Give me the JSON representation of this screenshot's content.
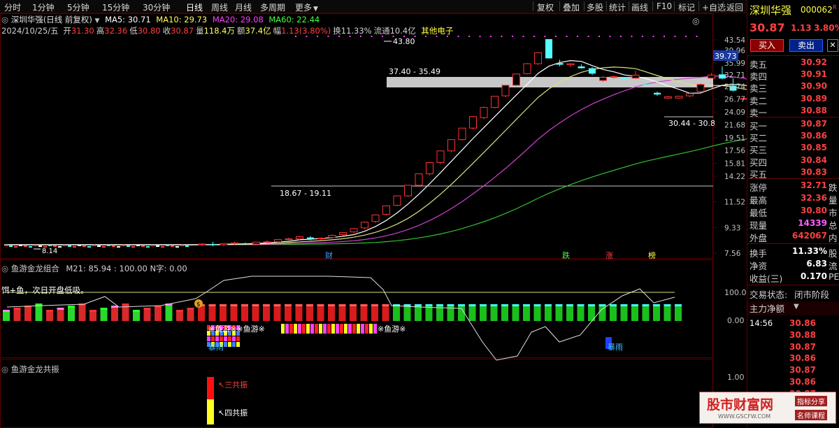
{
  "toolbar": {
    "timeframes": [
      "分时",
      "1分钟",
      "5分钟",
      "15分钟",
      "30分钟",
      "日线",
      "周线",
      "月线",
      "多周期",
      "更多"
    ],
    "active": "日线",
    "buttons": [
      "复权",
      "叠加",
      "多股",
      "统计",
      "画线",
      "F10",
      "标记",
      "+自选",
      "返回"
    ]
  },
  "chart_header": {
    "title": "深圳华强(日线 前复权)",
    "ma": [
      {
        "label": "MA5: 30.71",
        "color": "#ffffff"
      },
      {
        "label": "MA10: 29.73",
        "color": "#ffff60"
      },
      {
        "label": "MA20: 29.08",
        "color": "#ff40ff"
      },
      {
        "label": "MA60: 22.44",
        "color": "#40ff40"
      }
    ],
    "date": "2024/10/25/五",
    "quote": [
      {
        "label": "开",
        "value": "31.30",
        "color": "#ff4040"
      },
      {
        "label": "高",
        "value": "32.36",
        "color": "#ff4040"
      },
      {
        "label": "低",
        "value": "30.80",
        "color": "#ff4040"
      },
      {
        "label": "收",
        "value": "30.87",
        "color": "#ff4040"
      },
      {
        "label": "量",
        "value": "118.4万",
        "color": "#ffff60"
      },
      {
        "label": "额",
        "value": "37.4亿",
        "color": "#ffff60"
      },
      {
        "label": "幅",
        "value": "1.13(3.80%)",
        "color": "#ff4040"
      },
      {
        "label": "换",
        "value": "11.33%",
        "color": "#d0d0d0"
      },
      {
        "label": "流通",
        "value": "10.4亿",
        "color": "#d0d0d0"
      }
    ],
    "sector": "其他电子"
  },
  "price_axis": {
    "labels": [
      "43.54",
      "39.96",
      "35.99",
      "32.71",
      "29.74",
      "26.77",
      "24.09",
      "21.68",
      "19.51",
      "17.56",
      "15.81",
      "14.22",
      "11.52",
      "9.33",
      "7.56"
    ],
    "cursor_value": "39.73"
  },
  "annotations": {
    "peak": "43.80",
    "range_top": "37.40 - 35.49",
    "range_mid": "18.67 - 19.11",
    "range_right": "30.44 - 30.8",
    "low": "8.14",
    "markers": [
      {
        "text": "财",
        "color": "#40a0ff"
      },
      {
        "text": "跌",
        "color": "#40ff40"
      },
      {
        "text": "涨",
        "color": "#ff4040"
      },
      {
        "text": "榜",
        "color": "#ffff40"
      }
    ]
  },
  "indicator1": {
    "title": "鱼游金龙组合",
    "values": "M21: 85.94 : 100.00 N字: 0.00",
    "note": "饵+鱼，次日开盘低吸。",
    "axis": [
      "100.0",
      "0.00"
    ],
    "fish_label": "※鱼游※※鱼游※",
    "fish_label2": "※鱼游※",
    "rain": "暴雨"
  },
  "indicator2": {
    "title": "鱼游金龙共振",
    "axis": [
      "1.00"
    ],
    "label_three": "三共振",
    "label_four": "四共振"
  },
  "sidebar": {
    "name": "深圳华强",
    "code": "000062",
    "price": "30.87",
    "change": "1.13",
    "pct": "3.80%",
    "buy_btn": "买入",
    "sell_btn": "卖出",
    "asks": [
      {
        "label": "卖五",
        "price": "30.92"
      },
      {
        "label": "卖四",
        "price": "30.91"
      },
      {
        "label": "卖三",
        "price": "30.90"
      },
      {
        "label": "卖二",
        "price": "30.89"
      },
      {
        "label": "卖一",
        "price": "30.88"
      }
    ],
    "bids": [
      {
        "label": "买一",
        "price": "30.87"
      },
      {
        "label": "买二",
        "price": "30.86"
      },
      {
        "label": "买三",
        "price": "30.85"
      },
      {
        "label": "买四",
        "price": "30.84"
      },
      {
        "label": "买五",
        "price": "30.83"
      }
    ],
    "stats": [
      {
        "label": "涨停",
        "value": "32.71",
        "cut": "跌",
        "color": "#ff4040"
      },
      {
        "label": "最高",
        "value": "32.36",
        "cut": "量",
        "color": "#ff4040"
      },
      {
        "label": "最低",
        "value": "30.80",
        "cut": "市",
        "color": "#ff4040"
      },
      {
        "label": "现量",
        "value": "14339",
        "cut": "总",
        "color": "#ff60ff"
      },
      {
        "label": "外盘",
        "value": "642067",
        "cut": "内",
        "color": "#ff4040"
      }
    ],
    "stats2": [
      {
        "label": "换手",
        "value": "11.33%",
        "cut": "股",
        "color": "#ffffff"
      },
      {
        "label": "净资",
        "value": "6.83",
        "cut": "流",
        "color": "#ffffff"
      },
      {
        "label": "收益(三)",
        "value": "0.170",
        "cut": "PE",
        "color": "#ffffff"
      }
    ],
    "status_label": "交易状态:",
    "status_value": "闭市阶段",
    "main_net": "主力净额",
    "ticks": [
      {
        "time": "14:56",
        "price": "30.86"
      },
      {
        "time": "",
        "price": "30.88"
      },
      {
        "time": "",
        "price": "30.87"
      },
      {
        "time": "",
        "price": "30.86"
      },
      {
        "time": "",
        "price": "30.87"
      },
      {
        "time": "",
        "price": "30.86"
      },
      {
        "time": "",
        "price": "30.87"
      }
    ]
  },
  "watermark": {
    "title": "股市财富网",
    "url": "WWW.GSCFW.COM",
    "tag1": "指标分享",
    "tag2": "名师课程"
  },
  "chart_data": {
    "type": "candlestick",
    "series_daily": [
      [
        8.1,
        8.2,
        8.0,
        8.15
      ],
      [
        8.15,
        8.3,
        8.0,
        8.1
      ],
      [
        8.1,
        8.2,
        8.0,
        8.18
      ],
      [
        8.2,
        8.3,
        8.1,
        8.22
      ],
      [
        8.2,
        8.25,
        8.1,
        8.15
      ],
      [
        8.15,
        8.3,
        8.1,
        8.28
      ],
      [
        8.3,
        8.4,
        8.2,
        8.3
      ],
      [
        8.3,
        8.5,
        8.2,
        8.45
      ],
      [
        8.5,
        8.6,
        8.4,
        8.5
      ],
      [
        8.5,
        8.7,
        8.4,
        8.65
      ],
      [
        8.6,
        8.7,
        8.4,
        8.5
      ],
      [
        8.5,
        8.6,
        8.4,
        8.55
      ],
      [
        8.6,
        8.8,
        8.5,
        8.75
      ],
      [
        8.8,
        9.0,
        8.7,
        8.95
      ],
      [
        9.0,
        9.3,
        8.9,
        9.25
      ],
      [
        9.3,
        9.8,
        9.2,
        9.75
      ],
      [
        9.8,
        10.4,
        9.7,
        10.35
      ],
      [
        10.4,
        11.2,
        10.3,
        11.15
      ],
      [
        11.2,
        12.1,
        11.1,
        12.1
      ],
      [
        12.1,
        13.2,
        12.0,
        13.2
      ],
      [
        13.2,
        14.5,
        13.0,
        14.5
      ],
      [
        14.5,
        15.9,
        14.3,
        15.9
      ],
      [
        15.9,
        17.5,
        15.7,
        17.5
      ],
      [
        17.5,
        19.2,
        17.3,
        19.2
      ],
      [
        19.2,
        21.1,
        19.0,
        21.1
      ],
      [
        21.1,
        23.2,
        20.9,
        23.2
      ],
      [
        23.0,
        25.2,
        22.7,
        25.0
      ],
      [
        25.0,
        27.4,
        24.8,
        27.4
      ],
      [
        27.5,
        30.1,
        27.2,
        30.0
      ],
      [
        30.0,
        32.9,
        29.8,
        32.9
      ],
      [
        33.0,
        36.0,
        32.8,
        35.8
      ],
      [
        35.8,
        39.4,
        35.5,
        39.2
      ],
      [
        43.8,
        43.8,
        37.4,
        37.4
      ],
      [
        36.0,
        37.0,
        35.0,
        35.5
      ],
      [
        35.5,
        36.0,
        34.8,
        35.8
      ],
      [
        35.0,
        35.6,
        34.4,
        34.5
      ],
      [
        34.5,
        34.8,
        32.6,
        33.0
      ],
      [
        31.2,
        32.3,
        30.8,
        32.0
      ],
      [
        32.0,
        32.5,
        31.7,
        32.2
      ],
      [
        31.8,
        32.0,
        31.4,
        31.5
      ],
      [
        31.8,
        33.8,
        31.6,
        32.6
      ],
      [
        30.2,
        30.5,
        29.8,
        30.0
      ],
      [
        28.2,
        28.5,
        27.5,
        27.8
      ],
      [
        27.0,
        27.5,
        26.8,
        27.3
      ],
      [
        27.0,
        27.5,
        26.9,
        27.4
      ],
      [
        27.5,
        28.2,
        27.2,
        28.0
      ],
      [
        28.5,
        30.5,
        28.3,
        30.2
      ],
      [
        31.8,
        33.2,
        31.7,
        32.6
      ],
      [
        32.8,
        35.0,
        31.5,
        31.7
      ],
      [
        29.9,
        31.8,
        28.5,
        28.7
      ],
      [
        26.8,
        27.3,
        26.7,
        26.9
      ],
      [
        25.5,
        28.2,
        25.0,
        27.8
      ],
      [
        28.0,
        28.5,
        27.6,
        28.2
      ],
      [
        27.2,
        27.6,
        27.0,
        27.0
      ],
      [
        26.8,
        29.0,
        26.5,
        28.9
      ],
      [
        31.0,
        32.0,
        30.5,
        31.6
      ],
      [
        32.0,
        33.5,
        31.5,
        32.4
      ],
      [
        30.3,
        32.0,
        30.0,
        31.5
      ],
      [
        31.6,
        34.2,
        31.4,
        32.0
      ],
      [
        31.3,
        31.4,
        30.2,
        30.2
      ],
      [
        29.9,
        30.5,
        29.6,
        30.2
      ],
      [
        30.3,
        32.4,
        30.2,
        31.5
      ]
    ]
  }
}
